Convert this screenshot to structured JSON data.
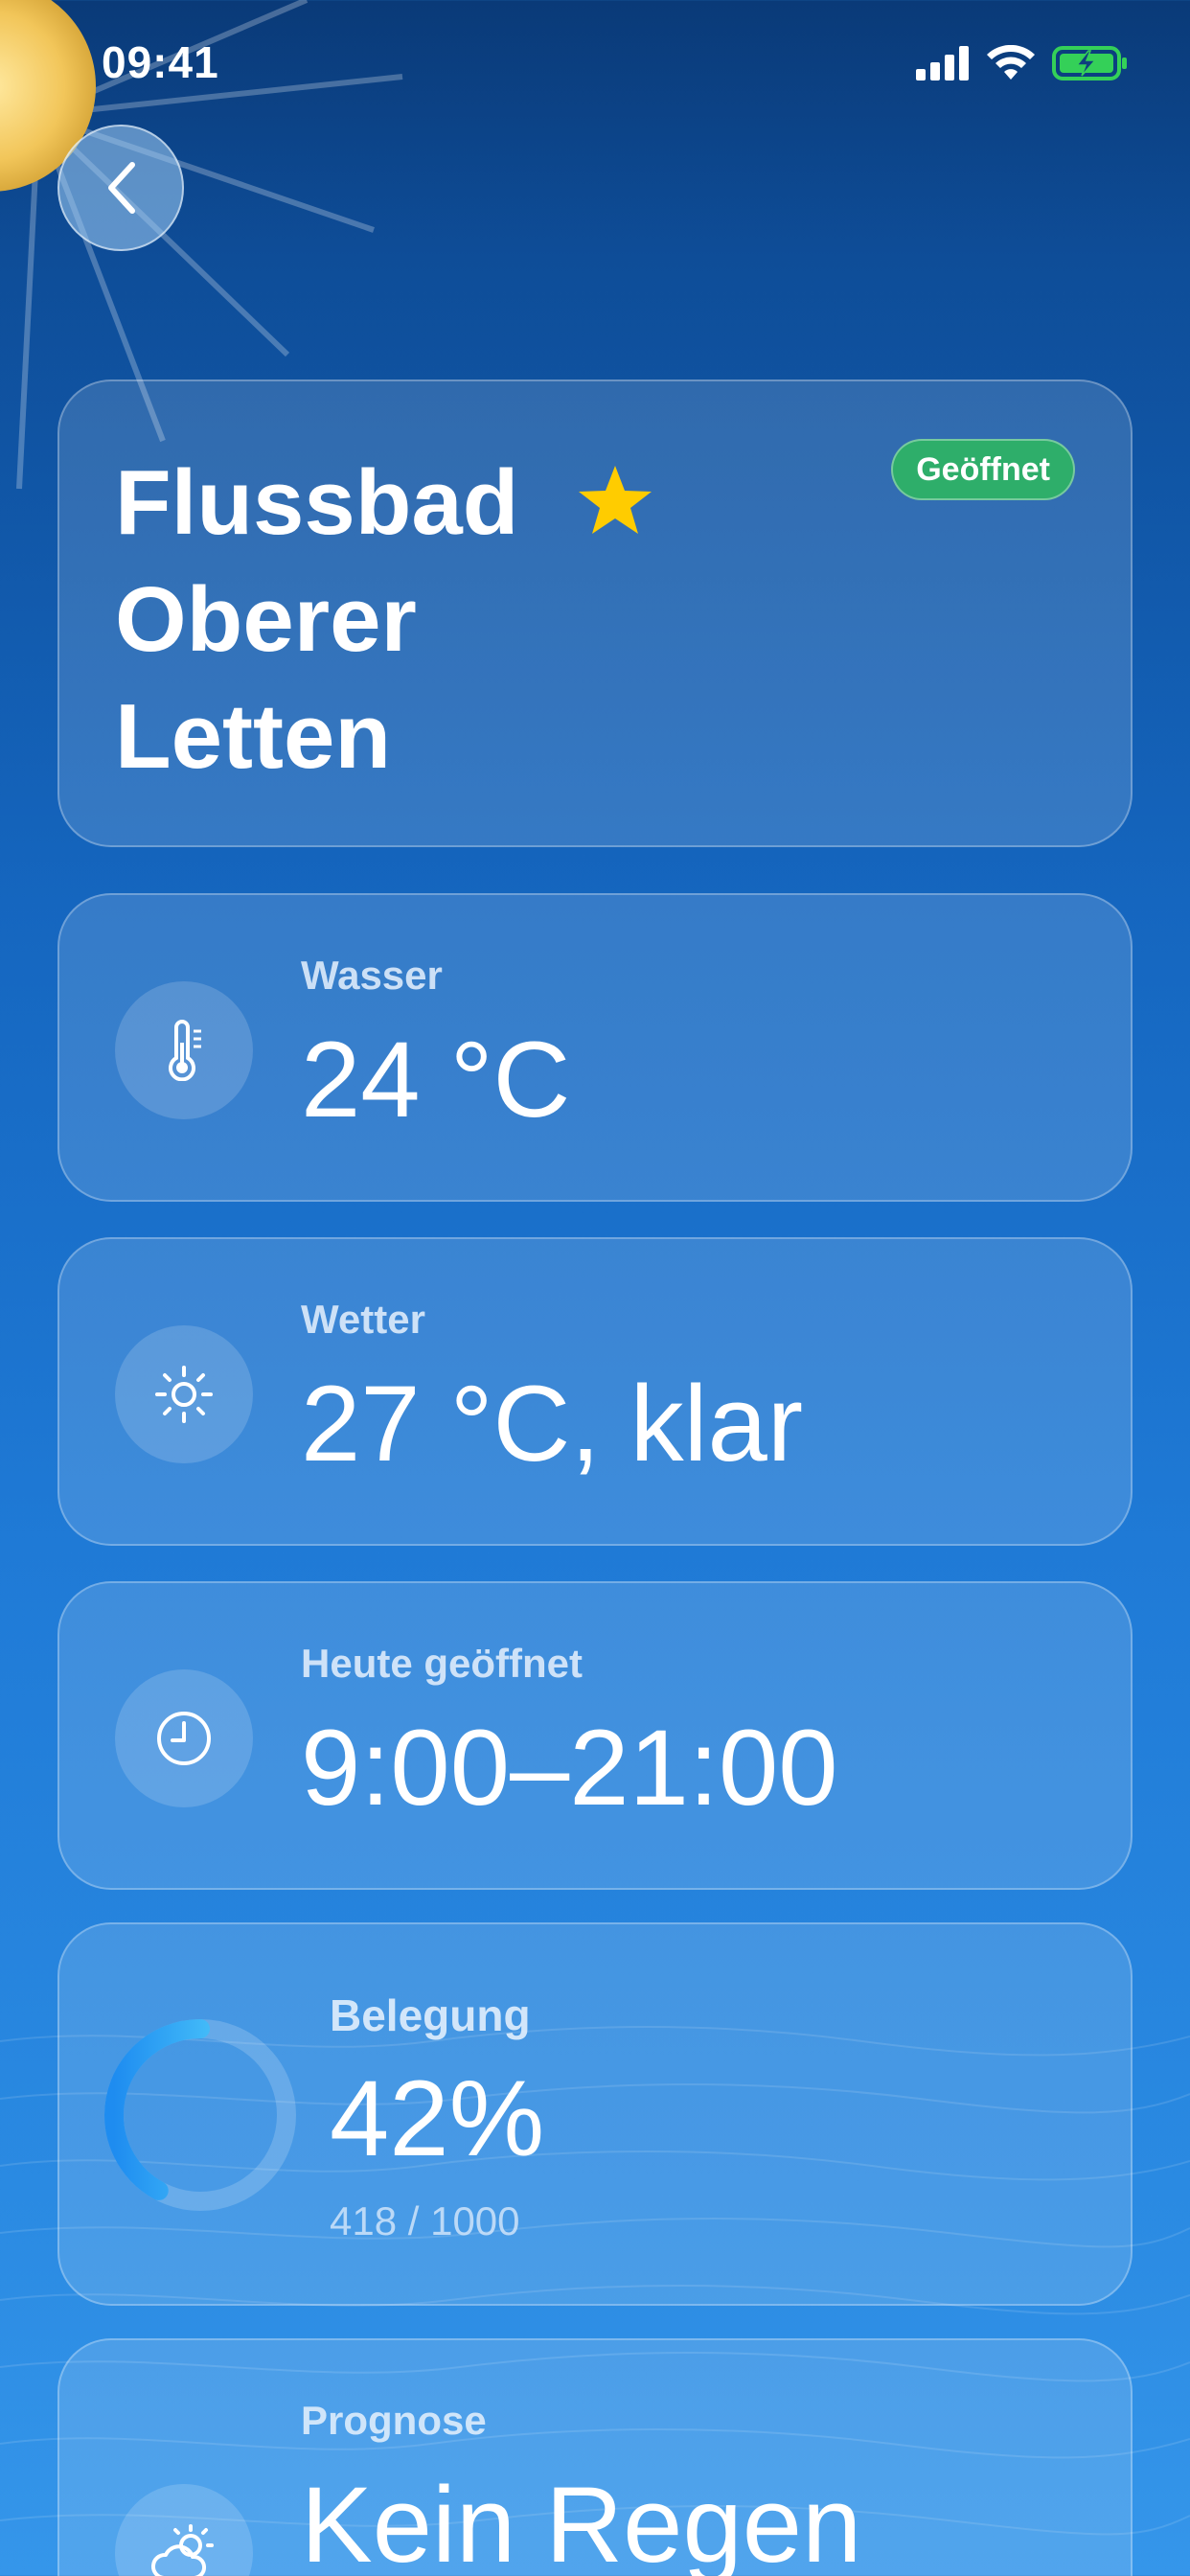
{
  "status_bar": {
    "time": "09:41"
  },
  "pool": {
    "name": "Flussbad Oberer Letten",
    "status": "Geöffnet",
    "favorite": true
  },
  "cards": {
    "water": {
      "label": "Wasser",
      "value": "24 °C",
      "icon": "thermometer-icon"
    },
    "weather": {
      "label": "Wetter",
      "value": "27 °C, klar",
      "icon": "sun-icon"
    },
    "hours": {
      "label": "Heute geöffnet",
      "value": "9:00–21:00",
      "icon": "clock-icon"
    },
    "occupancy": {
      "label": "Belegung",
      "value": "42%",
      "detail": "418 / 1000",
      "fraction": 0.42
    },
    "forecast": {
      "label": "Prognose",
      "value": "Kein Regen",
      "icon": "cloud-sun-icon"
    }
  },
  "colors": {
    "badge_green": "#2eae6a",
    "star_yellow": "#ffcc00",
    "ring_cyan": "#46c8ff",
    "battery_green": "#34d058"
  }
}
